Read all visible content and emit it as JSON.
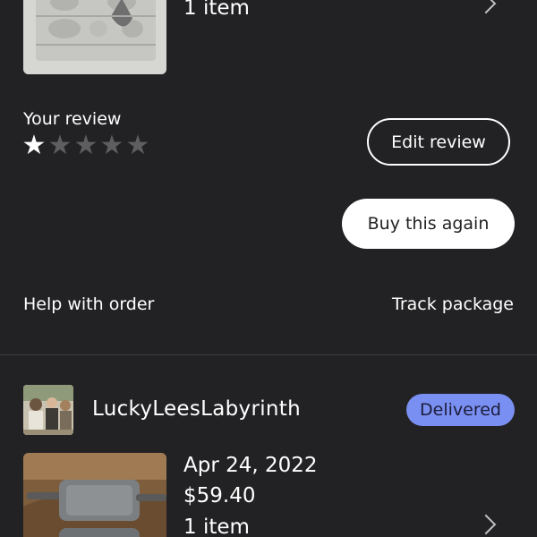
{
  "previous_order": {
    "item_count": "1 item",
    "thumbnail_icon": "lead-mold-product-photo",
    "review": {
      "label": "Your review",
      "rating": 1,
      "max_rating": 5
    },
    "edit_review_label": "Edit review",
    "buy_again_label": "Buy this again",
    "help_label": "Help with order",
    "track_label": "Track package"
  },
  "order": {
    "shop_name": "LuckyLeesLabyrinth",
    "status": "Delivered",
    "date": "Apr 24, 2022",
    "price": "$59.40",
    "item_count": "1 item",
    "avatar_icon": "shop-avatar-photo",
    "thumbnail_icon": "cast-iron-mold-product-photo"
  },
  "colors": {
    "background": "#222224",
    "badge": "#7a8ff2",
    "star_filled": "#ffffff",
    "star_empty": "#5e5e60"
  }
}
